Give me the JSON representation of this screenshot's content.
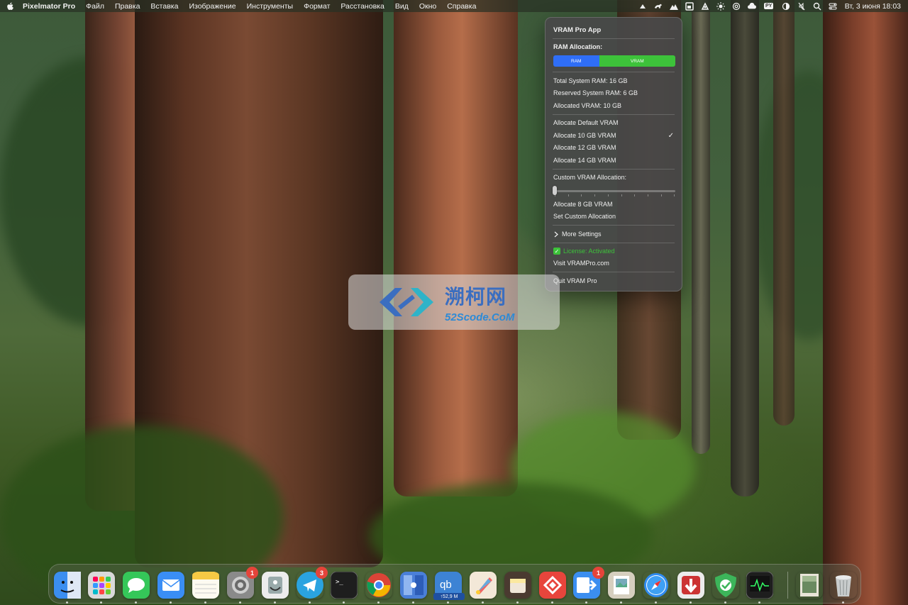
{
  "menubar": {
    "app_name": "Pixelmator Pro",
    "items": [
      "Файл",
      "Правка",
      "Вставка",
      "Изображение",
      "Инструменты",
      "Формат",
      "Расстановка",
      "Вид",
      "Окно",
      "Справка"
    ],
    "status_icons": [
      "vram-pro-icon",
      "horse-icon",
      "mountain-icon",
      "window-icon",
      "paint-icon",
      "brightness-icon",
      "at-icon",
      "creative-cloud-icon",
      "keyboard-layout-icon",
      "halfmoon-icon",
      "mute-icon",
      "search-icon",
      "control-center-icon"
    ],
    "keyboard_layout": "PY",
    "clock": "Вт, 3 июня  18:03"
  },
  "vram_menu": {
    "title": "VRAM Pro App",
    "ram_allocation_label": "RAM Allocation:",
    "bar": {
      "ram_label": "RAM",
      "vram_label": "VRAM",
      "vram_fraction": 0.625,
      "ram_color": "#2f6ef7",
      "vram_color": "#3dc23a"
    },
    "total_ram": "Total System RAM: 16 GB",
    "reserved_ram": "Reserved System RAM: 6 GB",
    "allocated_vram": "Allocated VRAM: 10 GB",
    "options": [
      "Allocate Default VRAM",
      "Allocate 10 GB VRAM",
      "Allocate 12 GB VRAM",
      "Allocate 14 GB VRAM"
    ],
    "checked_option": "Allocate 10 GB VRAM",
    "checkmark": "✓",
    "custom_label": "Custom VRAM Allocation:",
    "slider_value": 0,
    "allocate_8": "Allocate 8 GB VRAM",
    "set_custom": "Set Custom Allocation",
    "more_settings": "More Settings",
    "license": "License: Activated",
    "visit": "Visit VRAMPro.com",
    "quit": "Quit VRAM Pro"
  },
  "watermark": {
    "cn": "溯柯网",
    "en": "52Scode.CoM"
  },
  "dock": {
    "apps": [
      {
        "name": "finder",
        "color": "#3b8ef0"
      },
      {
        "name": "launchpad",
        "color": "#8a8a8a"
      },
      {
        "name": "messages",
        "color": "#35c759"
      },
      {
        "name": "mail",
        "color": "#3a8ef5"
      },
      {
        "name": "notes",
        "color": "#f5f0e0"
      },
      {
        "name": "system-settings",
        "color": "#7a7a7a",
        "badge": "1"
      },
      {
        "name": "disk-utility",
        "color": "#e8e8e8"
      },
      {
        "name": "telegram",
        "color": "#2aa3e0",
        "badge": "3"
      },
      {
        "name": "terminal",
        "color": "#1e1e1e"
      },
      {
        "name": "chrome",
        "color": "#ffffff"
      },
      {
        "name": "screen-sharing",
        "color": "#4a7fd8"
      },
      {
        "name": "qbittorrent",
        "color": "#3d83d4",
        "label": "↑52,9 M"
      },
      {
        "name": "pixelmator-pro",
        "color": "#f3e8d8"
      },
      {
        "name": "vram-pro",
        "color": "#4a3a30"
      },
      {
        "name": "anydesk",
        "color": "#e8453c"
      },
      {
        "name": "migration-assistant",
        "color": "#3b8ef0",
        "badge": "1"
      },
      {
        "name": "preview",
        "color": "#c8c0b0"
      },
      {
        "name": "safari",
        "color": "#2f8bf0"
      },
      {
        "name": "downie",
        "color": "#e8e8e8"
      },
      {
        "name": "adguard",
        "color": "#3cb55a"
      },
      {
        "name": "activity-monitor",
        "color": "#1e1e1e"
      },
      {
        "name": "downloads-stack",
        "color": "#8a9a80"
      },
      {
        "name": "trash",
        "color": "#9aa0a0"
      }
    ]
  }
}
